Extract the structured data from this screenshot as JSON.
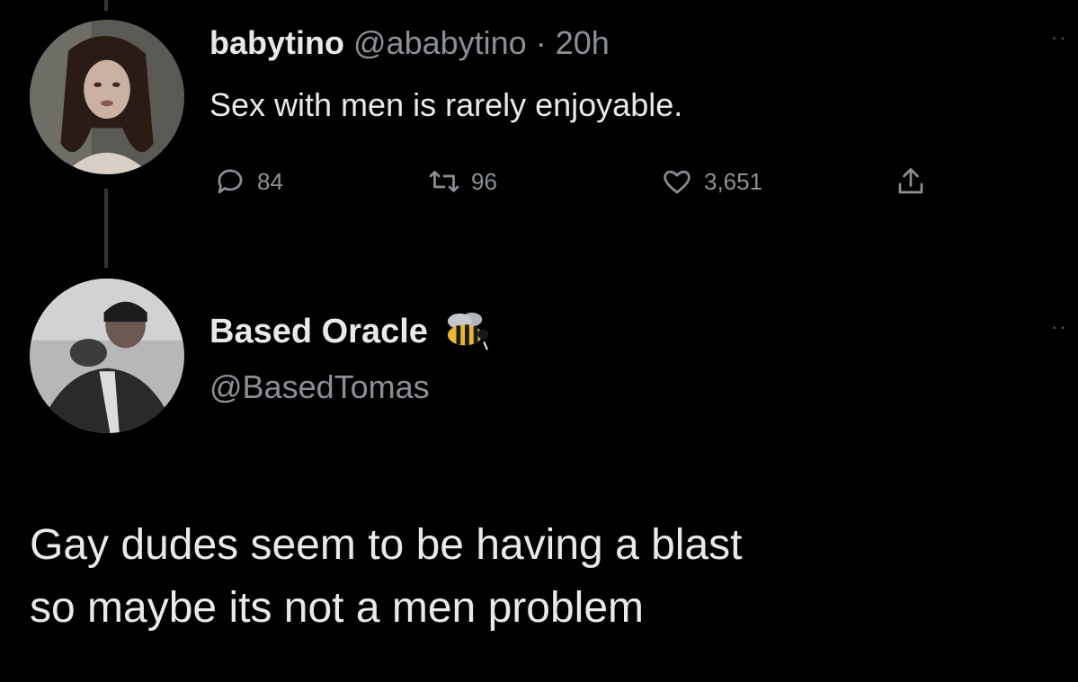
{
  "colors": {
    "background": "#000000",
    "text_primary": "#e7e9ea",
    "text_secondary": "#8b9096",
    "thread_line": "#333639"
  },
  "original_tweet": {
    "display_name": "babytino",
    "handle": "@ababytino",
    "separator": "·",
    "time": "20h",
    "text": "Sex with men is rarely enjoyable.",
    "reply_count": "84",
    "retweet_count": "96",
    "like_count": "3,651",
    "icons": [
      "reply-icon",
      "retweet-icon",
      "like-icon",
      "share-icon",
      "more-icon"
    ]
  },
  "reply_tweet": {
    "display_name": "Based Oracle",
    "emoji": "bee-icon",
    "handle": "@BasedTomas",
    "text_lines": [
      "Gay dudes seem to be having a blast",
      "so maybe its not a men problem"
    ]
  }
}
